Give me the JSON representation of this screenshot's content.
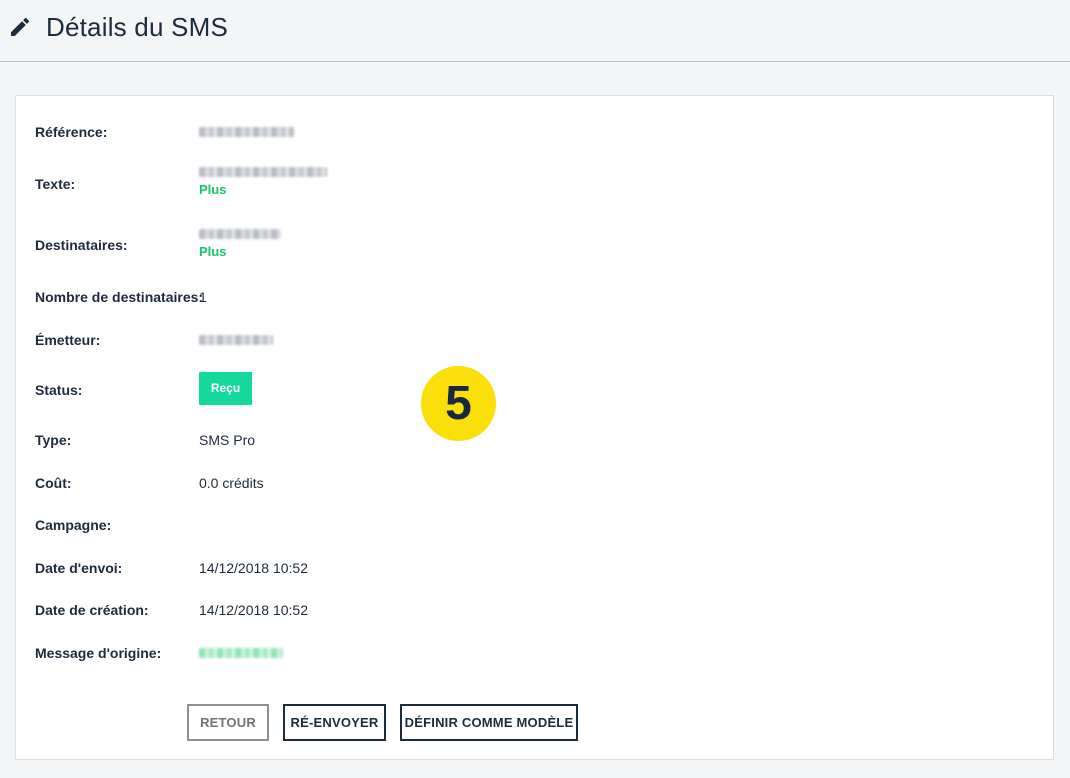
{
  "header": {
    "title": "Détails du SMS",
    "icon": "pencil-icon"
  },
  "details": {
    "reference_label": "Référence:",
    "texte_label": "Texte:",
    "texte_more": "Plus",
    "destinataires_label": "Destinataires:",
    "destinataires_more": "Plus",
    "nombre_label": "Nombre de destinataires:",
    "nombre_value": "1",
    "emetteur_label": "Émetteur:",
    "status_label": "Status:",
    "status_value": "Reçu",
    "type_label": "Type:",
    "type_value": "SMS Pro",
    "cout_label": "Coût:",
    "cout_value": "0.0 crédits",
    "campagne_label": "Campagne:",
    "campagne_value": "",
    "date_envoi_label": "Date d'envoi:",
    "date_envoi_value": "14/12/2018 10:52",
    "date_creation_label": "Date de création:",
    "date_creation_value": "14/12/2018 10:52",
    "message_origine_label": "Message d'origine:"
  },
  "step_marker": "5",
  "actions": {
    "retour": "RETOUR",
    "renvoyer": "RÉ-ENVOYER",
    "definir_modele": "DÉFINIR COMME MODÈLE"
  },
  "colors": {
    "primary": "#1d2b3c",
    "accent_green": "#19c26a",
    "status_badge": "#14d99a",
    "marker": "#fadf0a"
  }
}
